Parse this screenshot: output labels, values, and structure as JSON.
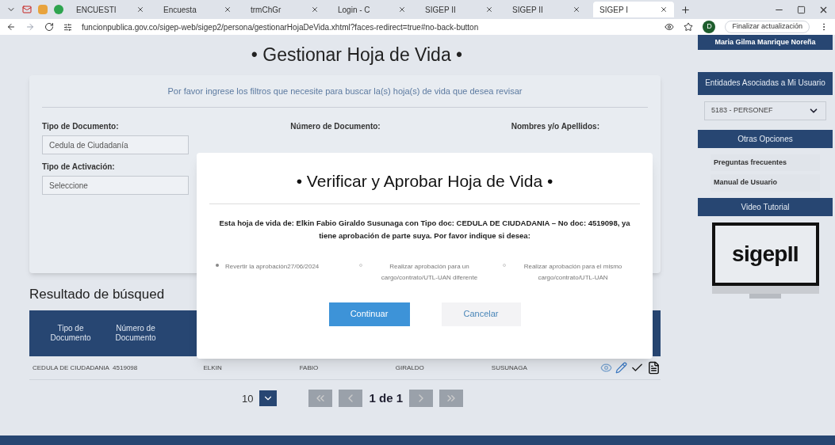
{
  "browser": {
    "tabs": [
      {
        "label": "ENCUESTI",
        "selected": false
      },
      {
        "label": "Encuesta",
        "selected": false
      },
      {
        "label": "trmChGr",
        "selected": false
      },
      {
        "label": "Login - C",
        "selected": false
      },
      {
        "label": "SIGEP II",
        "selected": false
      },
      {
        "label": "SIGEP II",
        "selected": false
      },
      {
        "label": "SIGEP I",
        "selected": true
      }
    ],
    "url": "funcionpublica.gov.co/sigep-web/sigep2/persona/gestionarHojaDeVida.xhtml?faces-redirect=true#no-back-button",
    "profile_initial": "D",
    "update_button": "Finalizar actualización"
  },
  "page": {
    "title": "• Gestionar Hoja de Vida •",
    "instructions": "Por favor ingrese los filtros que necesite para buscar la(s) hoja(s) de vida que desea revisar",
    "filters": [
      {
        "label": "Tipo de Documento:",
        "value": "Cedula de Ciudadanía"
      },
      {
        "label": "Número de Documento:"
      },
      {
        "label": "Nombres y/o Apellidos:"
      },
      {
        "label": "Tipo de Activación:",
        "value": "Seleccione"
      }
    ],
    "results_title": "Resultado de búsqued",
    "table": {
      "columns": [
        "Tipo de Documento",
        "Número de Documento"
      ],
      "rows": [
        {
          "cells": [
            "CEDULA DE CIUDADANIA",
            "4519098",
            "ELKIN",
            "FABIO",
            "GIRALDO",
            "SUSUNAGA"
          ]
        }
      ]
    },
    "pagination": {
      "page_size": "10",
      "page_info": "1 de 1"
    }
  },
  "sidebar": {
    "user": "Maria Gilma Manrique Noreña",
    "entities_title": "Entidades Asociadas a Mi Usuario",
    "entity": "5183 - PERSONEF",
    "options_title": "Otras Opciones",
    "links": [
      "Preguntas frecuentes",
      "Manual de Usuario"
    ],
    "video_title": "Video Tutorial",
    "logo_text": "sigepII"
  },
  "dialog": {
    "title": "• Verificar y Aprobar Hoja de Vida •",
    "message": "Esta hoja de vida de: Elkin Fabio Giraldo Susunaga con Tipo doc: CEDULA DE CIUDADANIA – No doc: 4519098, ya tiene aprobación de parte suya. Por favor indique si desea:",
    "options": [
      {
        "label": "Revertir la aprobación27/06/2024",
        "selected": true
      },
      {
        "label": "Realizar aprobación para un cargo/contrato/UTL-UAN diferente",
        "selected": false
      },
      {
        "label": "Realizar aprobación para el mismo cargo/contrato/UTL-UAN",
        "selected": false
      }
    ],
    "buttons": [
      "Continuar",
      "Cancelar"
    ]
  }
}
